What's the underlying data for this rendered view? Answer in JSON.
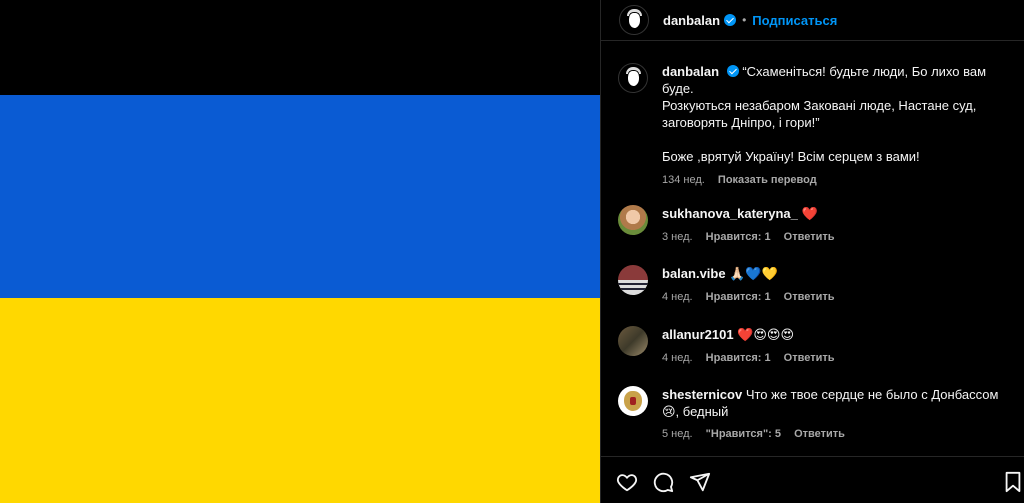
{
  "post": {
    "author": "danbalan",
    "follow_label": "Подписаться",
    "separator": "•"
  },
  "caption": {
    "username": "danbalan",
    "text_line1": "“Схаменіться! будьте люди, Бо лихо вам",
    "text_line2": "буде.",
    "text_line3": "Розкуються незабаром Заковані люде, Настане суд,",
    "text_line4": "заговорять Дніпро, і гори!”",
    "text_line5": "Боже ,врятуй Україну! Всім серцем з вами!",
    "time": "134 нед.",
    "translate_label": "Показать перевод"
  },
  "comments": [
    {
      "username": "sukhanova_kateryna_",
      "text": "❤️",
      "time": "3 нед.",
      "likes": "Нравится: 1",
      "reply": "Ответить"
    },
    {
      "username": "balan.vibe",
      "text": "🙏🏻💙💛",
      "time": "4 нед.",
      "likes": "Нравится: 1",
      "reply": "Ответить"
    },
    {
      "username": "allanur2101",
      "text": "❤️😍😍😍",
      "time": "4 нед.",
      "likes": "Нравится: 1",
      "reply": "Ответить"
    },
    {
      "username": "shesternicov",
      "text_line1": "Что же твое сердце не было с Донбассом",
      "text_line2": "😢, бедный",
      "time": "5 нед.",
      "likes": "\"Нравится\": 5",
      "reply": "Ответить"
    }
  ],
  "actions": {
    "icons": [
      "heart-icon",
      "comment-icon",
      "share-icon",
      "bookmark-icon"
    ]
  },
  "colors": {
    "flag_blue": "#0a5bd3",
    "flag_yellow": "#ffd800",
    "accent": "#0095f6",
    "background": "#000000"
  }
}
